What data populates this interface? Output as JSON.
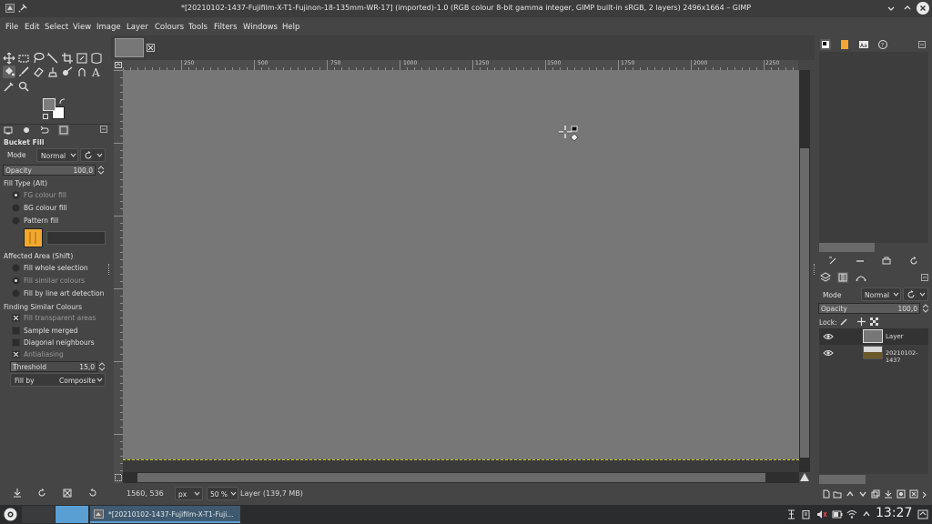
{
  "titlebar": {
    "title": "*[20210102-1437-Fujifilm-X-T1-Fujinon-18-135mm-WR-17] (imported)-1.0 (RGB colour 8-bit gamma integer, GIMP built-in sRGB, 2 layers) 2496x1664 – GIMP"
  },
  "menu": [
    "File",
    "Edit",
    "Select",
    "View",
    "Image",
    "Layer",
    "Colours",
    "Tools",
    "Filters",
    "Windows",
    "Help"
  ],
  "tool_options": {
    "title": "Bucket Fill",
    "mode_label": "Mode",
    "mode_value": "Normal",
    "opacity_label": "Opacity",
    "opacity_value": "100,0",
    "fill_type_label": "Fill Type  (Alt)",
    "fill_types": [
      "FG colour fill",
      "BG colour fill",
      "Pattern fill"
    ],
    "affected_area_label": "Affected Area  (Shift)",
    "affected_areas": [
      "Fill whole selection",
      "Fill similar colours",
      "Fill by line art detection"
    ],
    "finding_label": "Finding Similar Colours",
    "finding_options": [
      "Fill transparent areas",
      "Sample merged",
      "Diagonal neighbours",
      "Antialiasing"
    ],
    "threshold_label": "Threshold",
    "threshold_value": "15,0",
    "fill_by_label": "Fill by",
    "fill_by_value": "Composite"
  },
  "ruler": {
    "labels": [
      "250",
      "500",
      "750",
      "1000",
      "1250",
      "1500",
      "1750",
      "2000",
      "2250"
    ]
  },
  "status": {
    "coords": "1560, 536",
    "unit": "px",
    "zoom": "50 %",
    "layer_info": "Layer (139,7 MB)"
  },
  "layers_panel": {
    "mode_label": "Mode",
    "mode_value": "Normal",
    "opacity_label": "Opacity",
    "opacity_value": "100,0",
    "lock_label": "Lock:",
    "layers": [
      {
        "name": "Layer"
      },
      {
        "name": "20210102-1437"
      }
    ]
  },
  "taskbar": {
    "task_label": "*[20210102-1437-Fujifilm-X-T1-Fuji...",
    "clock": "13:27"
  },
  "colors": {
    "fg": "#7c7c7c",
    "bg": "#ffffff",
    "pattern": "#f0a830",
    "canvas": "#777777",
    "accent": "#5a9fd4"
  }
}
